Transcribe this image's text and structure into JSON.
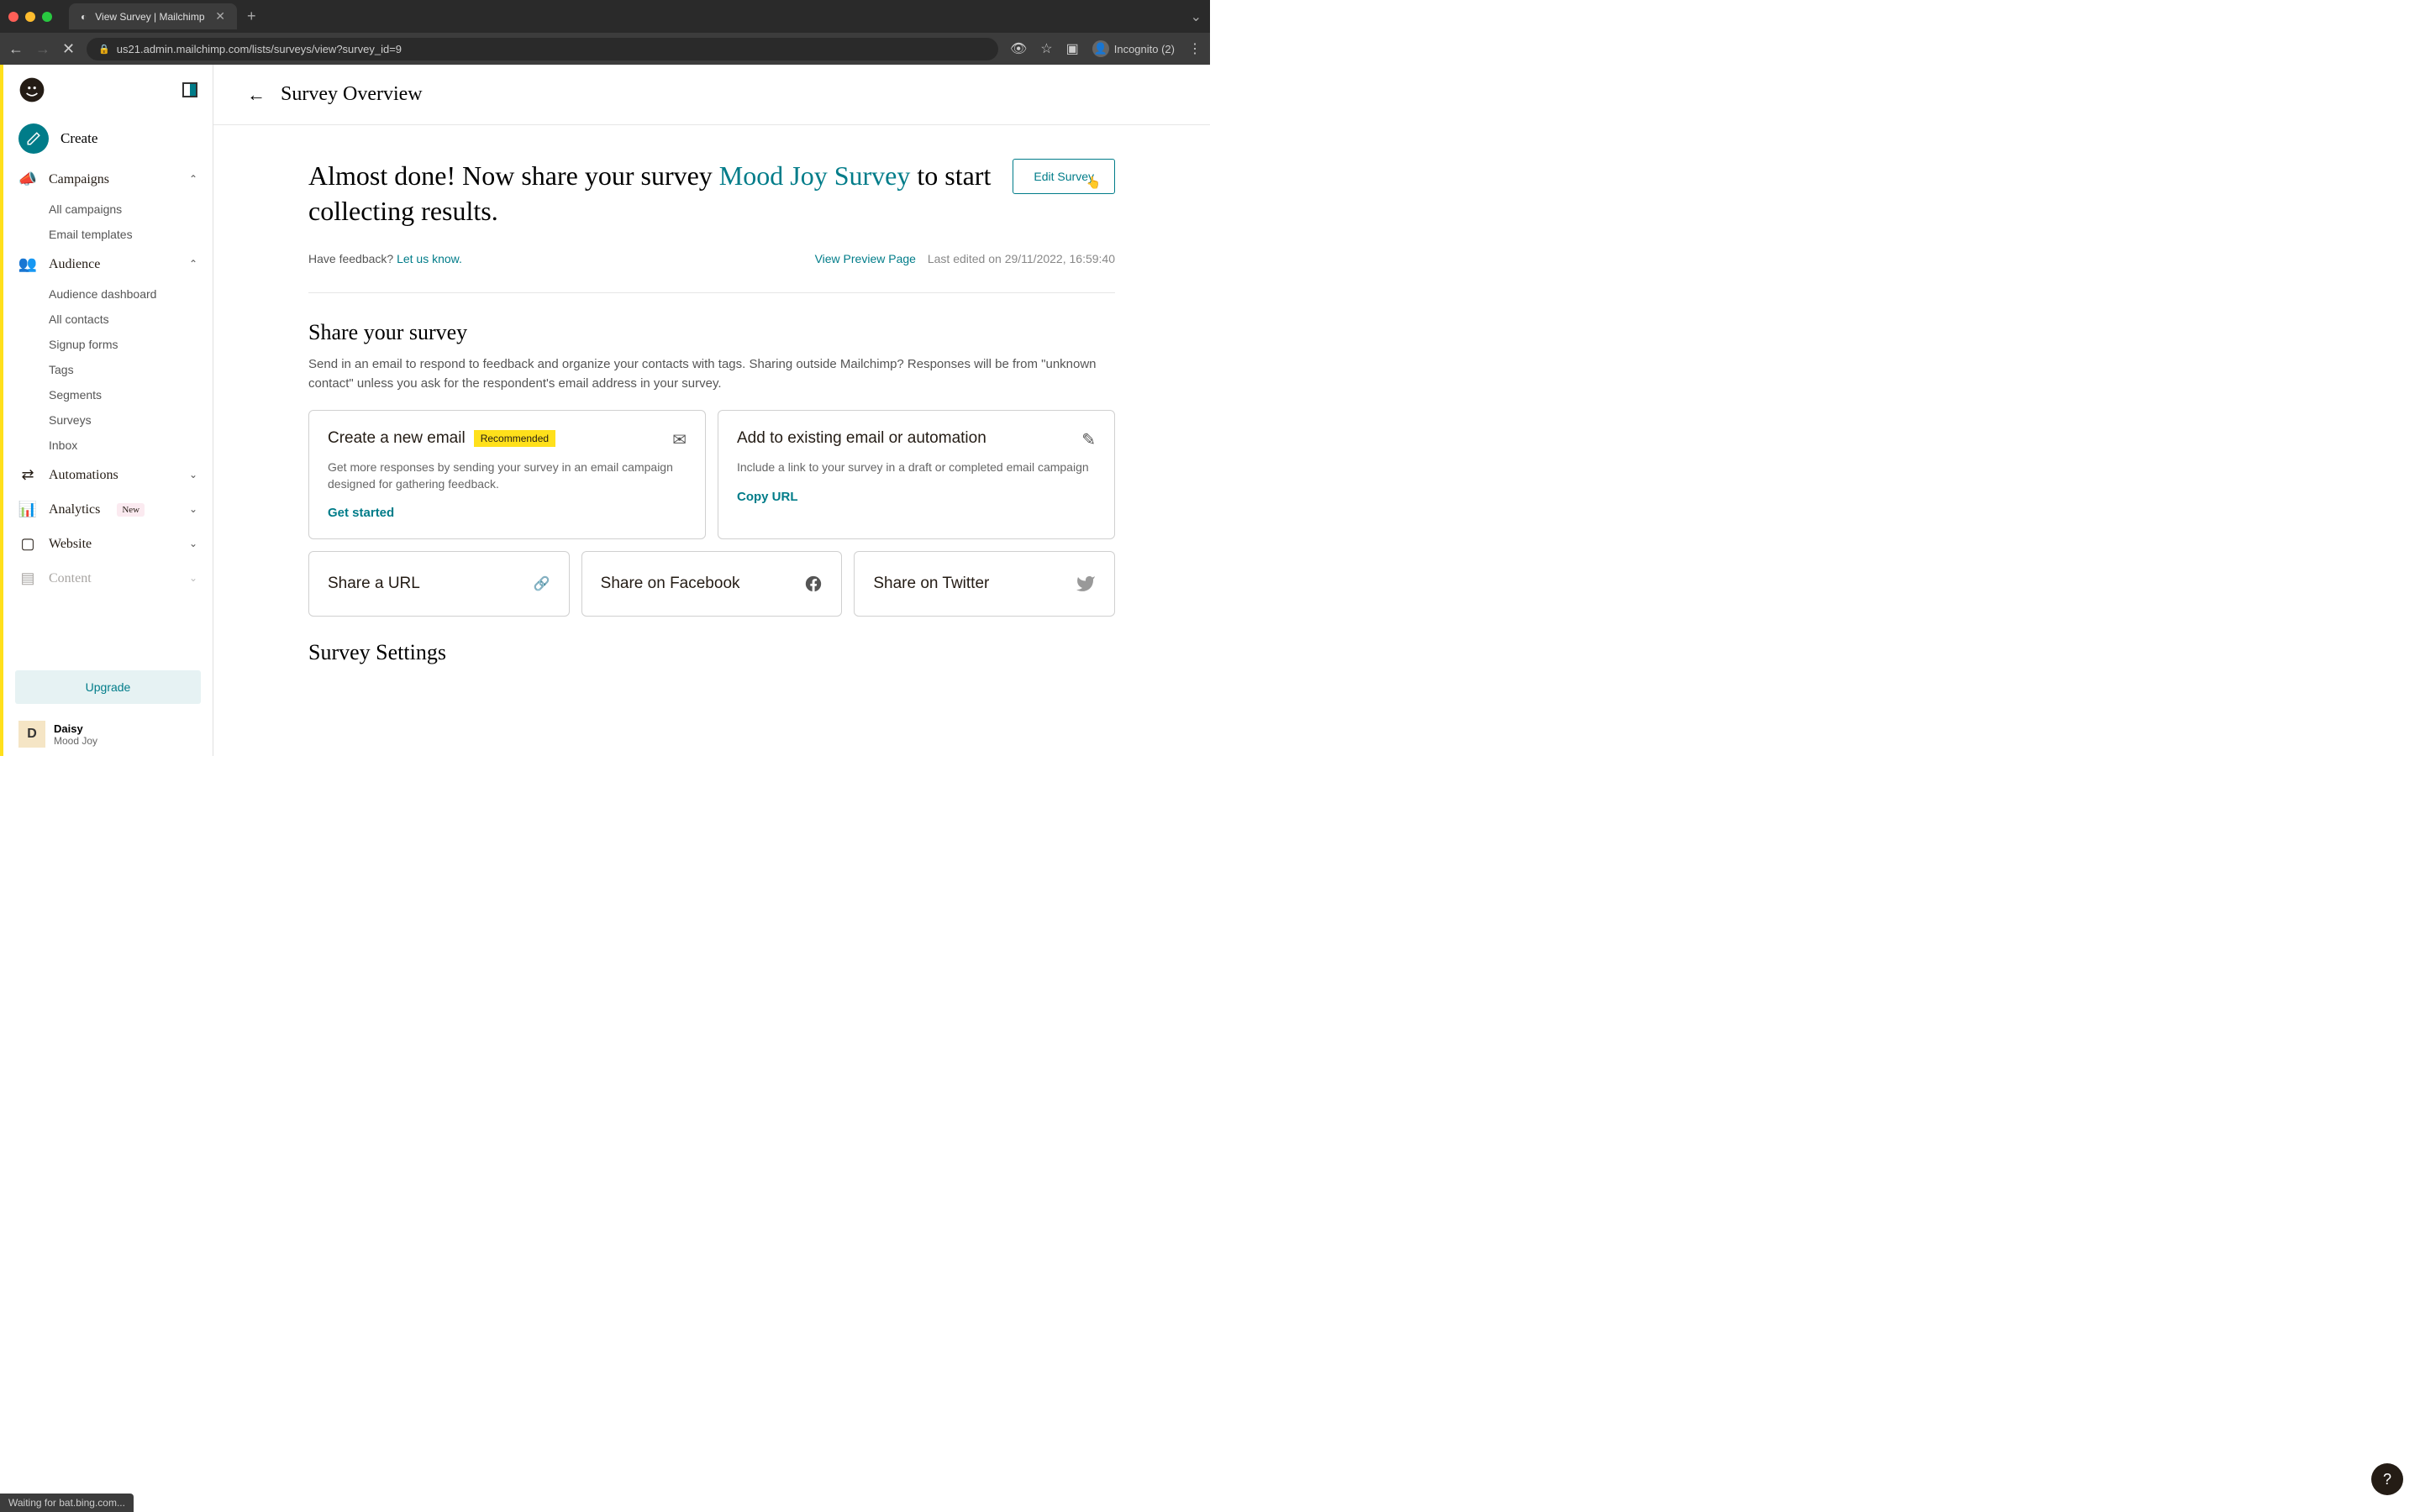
{
  "browser": {
    "tab_title": "View Survey | Mailchimp",
    "url": "us21.admin.mailchimp.com/lists/surveys/view?survey_id=9",
    "incognito_label": "Incognito (2)",
    "status_text": "Waiting for bat.bing.com..."
  },
  "sidebar": {
    "create_label": "Create",
    "nav": {
      "campaigns": {
        "label": "Campaigns",
        "items": [
          "All campaigns",
          "Email templates"
        ]
      },
      "audience": {
        "label": "Audience",
        "items": [
          "Audience dashboard",
          "All contacts",
          "Signup forms",
          "Tags",
          "Segments",
          "Surveys",
          "Inbox"
        ]
      },
      "automations": {
        "label": "Automations"
      },
      "analytics": {
        "label": "Analytics",
        "badge": "New"
      },
      "website": {
        "label": "Website"
      },
      "content": {
        "label": "Content"
      }
    },
    "upgrade_label": "Upgrade",
    "user": {
      "initial": "D",
      "name": "Daisy",
      "org": "Mood Joy"
    }
  },
  "page": {
    "title": "Survey Overview",
    "hero_prefix": "Almost done! Now share your survey ",
    "survey_name": "Mood Joy Survey",
    "hero_suffix": " to start collecting results.",
    "edit_button": "Edit Survey",
    "feedback_prompt": "Have feedback? ",
    "feedback_link": "Let us know.",
    "preview_link": "View Preview Page",
    "last_edited": "Last edited on 29/11/2022, 16:59:40",
    "share_title": "Share your survey",
    "share_desc": "Send in an email to respond to feedback and organize your contacts with tags. Sharing outside Mailchimp? Responses will be from \"unknown contact\" unless you ask for the respondent's email address in your survey.",
    "cards": {
      "email": {
        "title": "Create a new email",
        "badge": "Recommended",
        "desc": "Get more responses by sending your survey in an email campaign designed for gathering feedback.",
        "action": "Get started"
      },
      "existing": {
        "title": "Add to existing email or automation",
        "desc": "Include a link to your survey in a draft or completed email campaign",
        "action": "Copy URL"
      },
      "url": {
        "title": "Share a URL"
      },
      "facebook": {
        "title": "Share on Facebook"
      },
      "twitter": {
        "title": "Share on Twitter"
      }
    },
    "settings_title": "Survey Settings"
  }
}
